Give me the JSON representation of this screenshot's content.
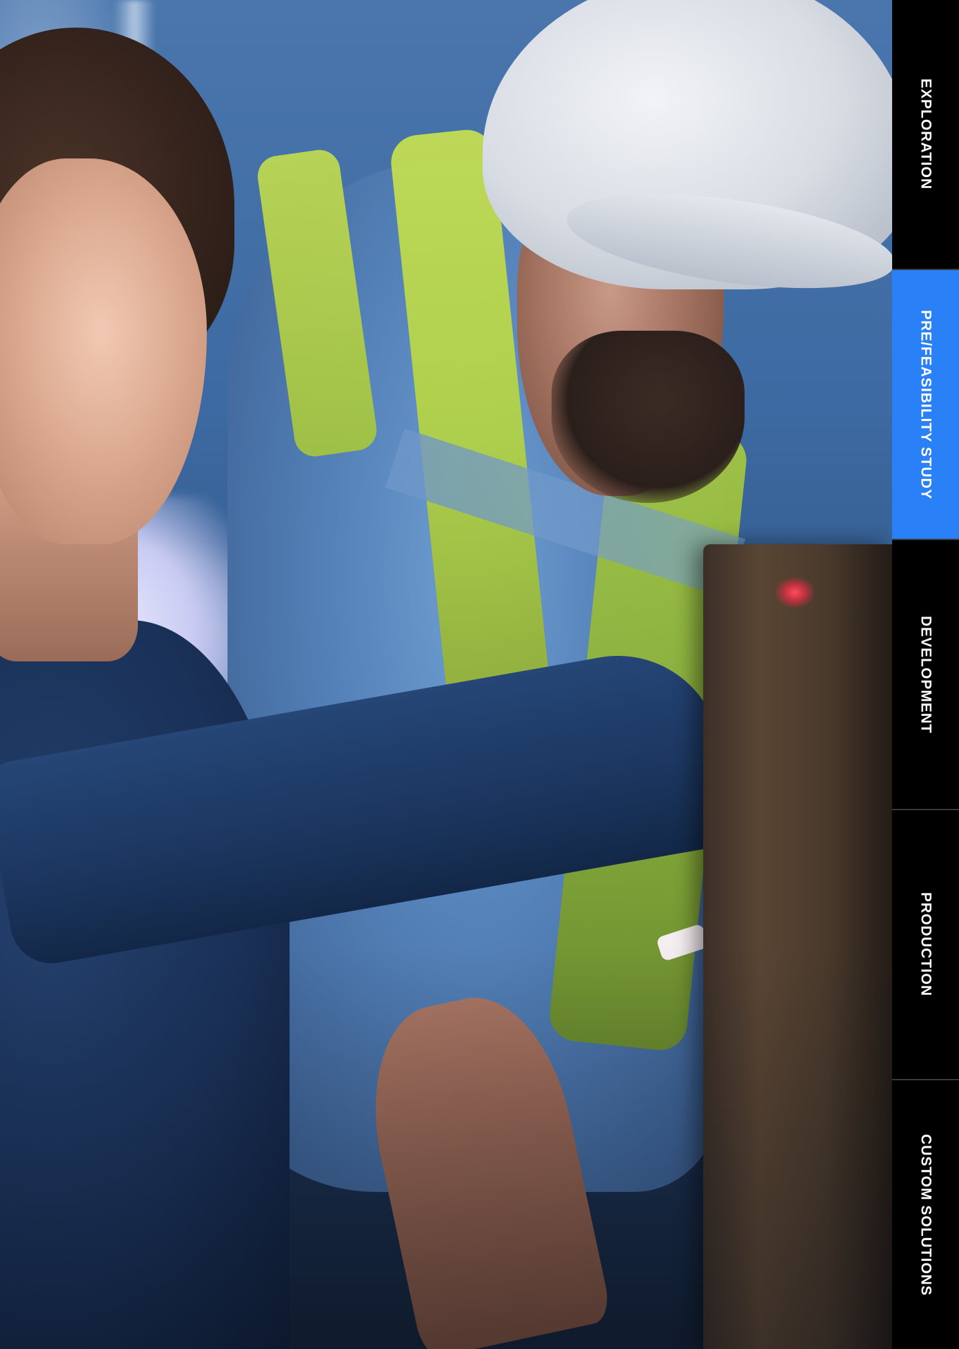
{
  "tabs": [
    {
      "label": "EXPLORATION",
      "active": false
    },
    {
      "label": "PRE/FEASIBILITY STUDY",
      "active": true
    },
    {
      "label": "DEVELOPMENT",
      "active": false
    },
    {
      "label": "PRODUCTION",
      "active": false
    },
    {
      "label": "CUSTOM SOLUTIONS",
      "active": false
    }
  ],
  "colors": {
    "active_tab": "#2a80f7",
    "tab_background": "#000000",
    "tab_text": "#ffffff",
    "divider": "#3a3a3a"
  }
}
